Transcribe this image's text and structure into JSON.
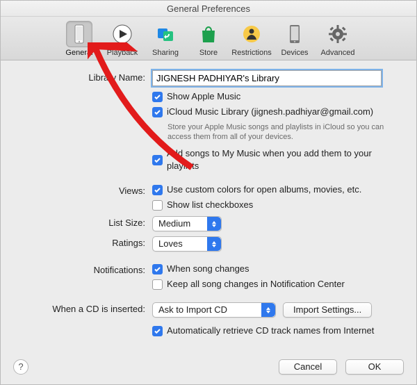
{
  "window": {
    "title": "General Preferences"
  },
  "toolbar": {
    "items": [
      {
        "label": "General",
        "selected": true
      },
      {
        "label": "Playback"
      },
      {
        "label": "Sharing"
      },
      {
        "label": "Store"
      },
      {
        "label": "Restrictions"
      },
      {
        "label": "Devices"
      },
      {
        "label": "Advanced"
      }
    ]
  },
  "labels": {
    "library_name": "Library Name:",
    "views": "Views:",
    "list_size": "List Size:",
    "ratings": "Ratings:",
    "notifications": "Notifications:",
    "cd_inserted": "When a CD is inserted:"
  },
  "fields": {
    "library_name_value": "JIGNESH PADHIYAR's Library",
    "show_apple_music": "Show Apple Music",
    "icloud_library": "iCloud Music Library (jignesh.padhiyar@gmail.com)",
    "icloud_note": "Store your Apple Music songs and playlists in iCloud so you can access them from all of your devices.",
    "add_songs": "Add songs to My Music when you add them to your playlists",
    "custom_colors": "Use custom colors for open albums, movies, etc.",
    "show_checkboxes": "Show list checkboxes",
    "list_size_value": "Medium",
    "ratings_value": "Loves",
    "when_song_changes": "When song changes",
    "keep_in_center": "Keep all song changes in Notification Center",
    "cd_action": "Ask to Import CD",
    "import_settings": "Import Settings...",
    "auto_retrieve": "Automatically retrieve CD track names from Internet"
  },
  "buttons": {
    "cancel": "Cancel",
    "ok": "OK",
    "help": "?"
  }
}
